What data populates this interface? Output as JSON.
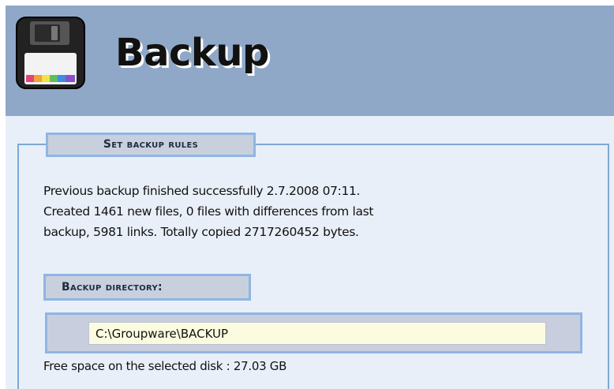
{
  "header": {
    "title": "Backup",
    "icon": "floppy-disk-icon",
    "background_color": "#90a8c8"
  },
  "rules_section": {
    "title": "Set backup rules"
  },
  "status": {
    "lines": [
      "Previous backup finished successfully 2.7.2008 07:11.",
      "Created 1461 new files, 0 files with differences from last",
      "backup, 5981 links. Totally copied 2717260452 bytes."
    ]
  },
  "backup_directory": {
    "label": "Backup directory:",
    "value": "C:\\Groupware\\BACKUP",
    "free_space_text": "Free space on the selected disk : 27.03 GB"
  },
  "colors": {
    "page_background": "#e9eff8",
    "accent_border": "#8fb6e4",
    "label_background": "#c9d0dd",
    "input_background": "#fbfbe0"
  }
}
